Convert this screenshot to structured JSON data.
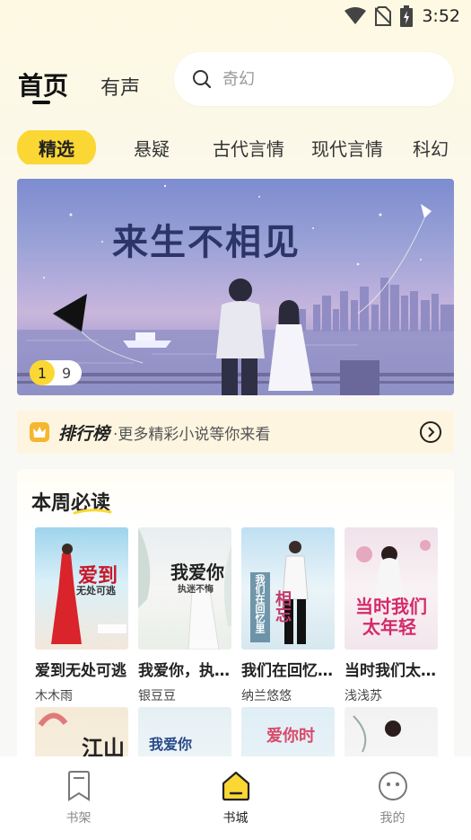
{
  "status_bar": {
    "time": "3:52",
    "icons": [
      "wifi-icon",
      "no-sim-icon",
      "battery-charging-icon"
    ]
  },
  "header": {
    "tabs": [
      {
        "label": "首页",
        "active": true
      },
      {
        "label": "有声",
        "active": false
      }
    ],
    "search": {
      "placeholder": "奇幻",
      "icon": "search-icon"
    }
  },
  "categories": [
    {
      "label": "精选",
      "active": true
    },
    {
      "label": "悬疑",
      "active": false
    },
    {
      "label": "古代言情",
      "active": false
    },
    {
      "label": "现代言情",
      "active": false
    },
    {
      "label": "科幻",
      "active": false
    }
  ],
  "banner": {
    "title": "来生不相见",
    "indicator_current": "1",
    "indicator_total": "9"
  },
  "ranking": {
    "title": "排行榜",
    "subtitle": "·更多精彩小说等你来看",
    "icon": "crown-icon",
    "arrow_icon": "chevron-right-circle-icon"
  },
  "weekly": {
    "title": "本周必读",
    "books": [
      {
        "title": "爱到无处可逃",
        "author": "木木雨",
        "cover_text": "爱到",
        "cover_sub": "无处可逃"
      },
      {
        "title": "我爱你，执迷不悔",
        "author": "银豆豆",
        "cover_text": "我爱你",
        "cover_sub": "执迷不悔"
      },
      {
        "title": "我们在回忆里相忘",
        "author": "纳兰悠悠",
        "cover_text": "相忘",
        "cover_sub": "我们在回忆里"
      },
      {
        "title": "当时我们太年轻",
        "author": "浅浅苏",
        "cover_text": "当时我们",
        "cover_sub": "太年轻"
      }
    ],
    "books_row2": [
      {
        "cover_text": "江山"
      },
      {
        "cover_text": "我爱你"
      },
      {
        "cover_text": "爱你时"
      },
      {
        "cover_text": ""
      }
    ]
  },
  "bottom_nav": [
    {
      "label": "书架",
      "icon": "bookmark-icon",
      "active": false
    },
    {
      "label": "书城",
      "icon": "bookstore-icon",
      "active": true
    },
    {
      "label": "我的",
      "icon": "profile-face-icon",
      "active": false
    }
  ],
  "colors": {
    "accent": "#fbd734",
    "ranking_bg": "#fdf5df"
  }
}
